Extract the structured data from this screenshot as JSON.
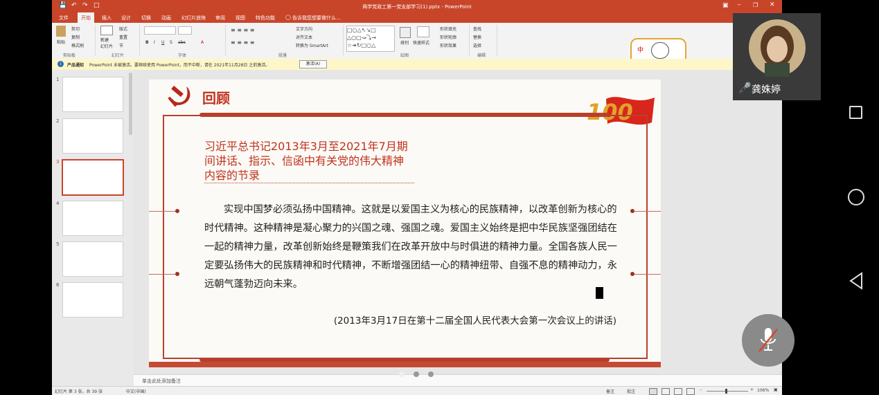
{
  "window": {
    "title": "两学党政工第一党支部学习(1).pptx - PowerPoint",
    "app": "PowerPoint"
  },
  "tabs": [
    "文件",
    "开始",
    "插入",
    "设计",
    "切换",
    "动画",
    "幻灯片放映",
    "审阅",
    "视图",
    "特色功能"
  ],
  "active_tab": "开始",
  "tell_me": "告诉我您想要做什么...",
  "ribbon": {
    "paste": "粘贴",
    "cut": "剪切",
    "copy": "复制",
    "format_painter": "格式刷",
    "new_slide": "新建\n幻灯片",
    "layout": "版式",
    "reset": "重置",
    "section": "节",
    "arrange": "排列",
    "quick_styles": "快速样式",
    "shape_fill": "形状填充",
    "shape_outline": "形状轮廓",
    "shape_effects": "形状效果",
    "find": "查找",
    "replace": "替换",
    "select": "选择",
    "text_direction": "文字方向",
    "align_text": "对齐文本",
    "convert_smartart": "转换为 SmartArt",
    "groups": [
      "剪贴板",
      "幻灯片",
      "字体",
      "段落",
      "绘图",
      "编辑"
    ]
  },
  "notice": {
    "label": "产品通知",
    "message": "PowerPoint 未被激活。要继续使用 PowerPoint，而不中断，请在 2021年11月28日 之前激活。",
    "button": "激活(A)"
  },
  "slides": [
    1,
    2,
    3,
    4,
    5,
    6
  ],
  "current_slide_index": 3,
  "slide": {
    "heading": "回顾",
    "subtitle": "习近平总书记2013年3月至2021年7月期间讲话、指示、信函中有关党的伟大精神内容的节录",
    "body": "实现中国梦必须弘扬中国精神。这就是以爱国主义为核心的民族精神，以改革创新为核心的时代精神。这种精神是凝心聚力的兴国之魂、强国之魂。爱国主义始终是把中华民族坚强团结在一起的精神力量，改革创新始终是鞭策我们在改革开放中与时俱进的精神力量。全国各族人民一定要弘扬伟大的民族精神和时代精神，不断增强团结一心的精神纽带、自强不息的精神动力，永远朝气蓬勃迈向未来。",
    "source": "(2013年3月17日在第十二届全国人民代表大会第一次会议上的讲话)",
    "badge": "100"
  },
  "notes_placeholder": "单击此处添加备注",
  "status": {
    "slide_count": "幻灯片 第 3 张，共 39 张",
    "language": "中文(中国)",
    "notes": "备注",
    "comments": "批注",
    "zoom": "106%"
  },
  "video": {
    "participant_name": "龚姝婷"
  },
  "colors": {
    "accent": "#c9452a",
    "slide_red": "#b8402b",
    "notice_bg": "#fdf6c9"
  }
}
